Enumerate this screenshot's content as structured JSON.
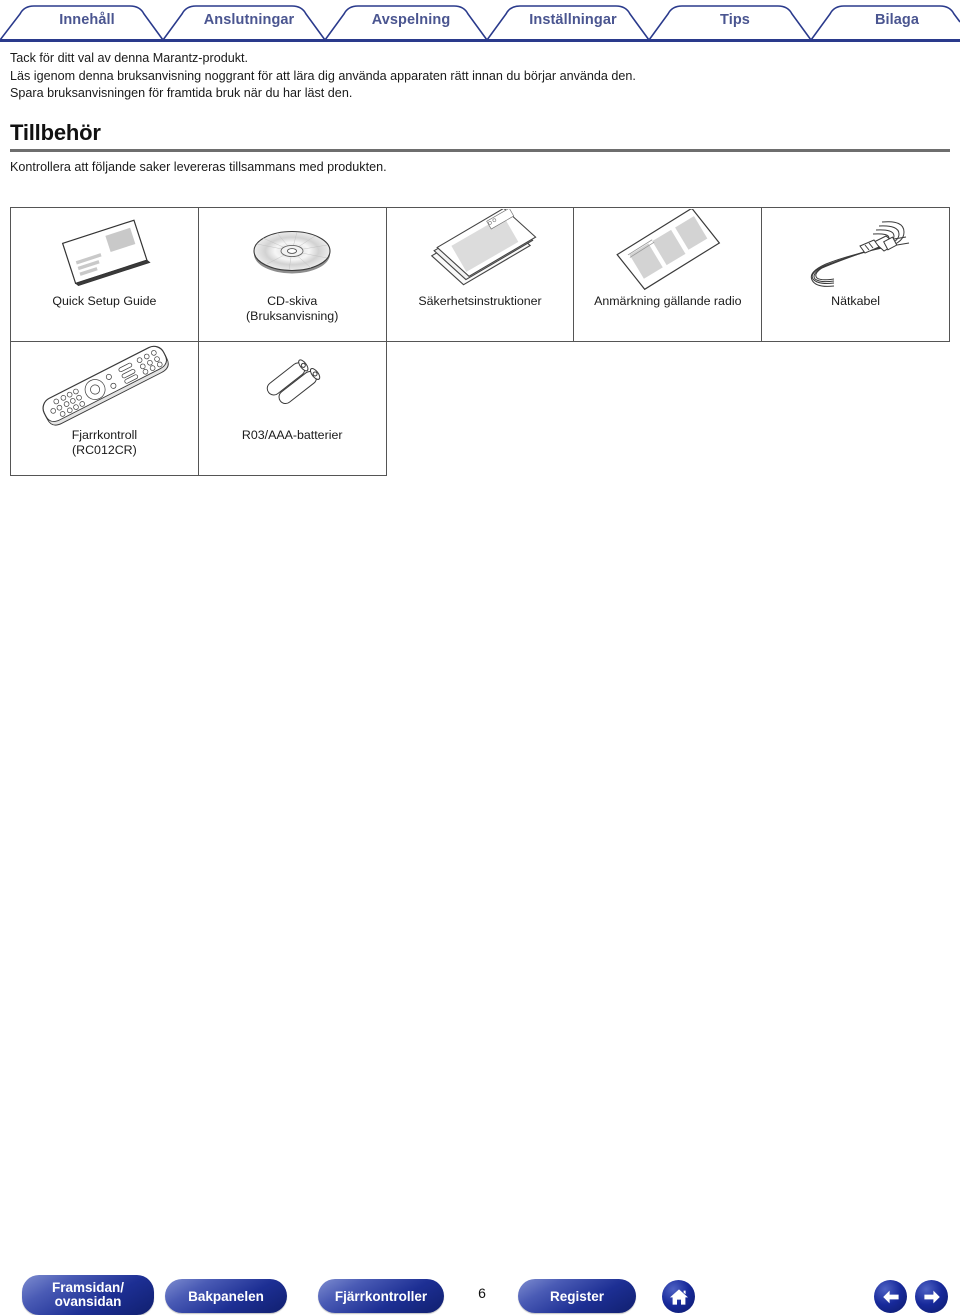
{
  "tabs": [
    {
      "label": "Innehåll"
    },
    {
      "label": "Anslutningar"
    },
    {
      "label": "Avspelning"
    },
    {
      "label": "Inställningar"
    },
    {
      "label": "Tips"
    },
    {
      "label": "Bilaga"
    }
  ],
  "intro": {
    "line1": "Tack för ditt val av denna Marantz-produkt.",
    "line2": "Läs igenom denna bruksanvisning noggrant för att lära dig använda apparaten rätt innan du börjar använda den.",
    "line3": "Spara bruksanvisningen för framtida bruk när du har läst den."
  },
  "section": {
    "heading": "Tillbehör",
    "subtitle": "Kontrollera att följande saker levereras tillsammans med produkten."
  },
  "accessories": [
    {
      "icon": "booklet-icon",
      "label": "Quick Setup Guide",
      "label2": ""
    },
    {
      "icon": "cd-disc-icon",
      "label": "CD-skiva",
      "label2": "(Bruksanvisning)"
    },
    {
      "icon": "papers-icon",
      "label": "Säkerhetsinstruktioner",
      "label2": ""
    },
    {
      "icon": "leaflet-icon",
      "label": "Anmärkning gällande radio",
      "label2": ""
    },
    {
      "icon": "power-cord-icon",
      "label": "Nätkabel",
      "label2": ""
    },
    {
      "icon": "remote-icon",
      "label": "Fjarrkontroll",
      "label2": "(RC012CR)"
    },
    {
      "icon": "batteries-icon",
      "label": "R03/AAA-batterier",
      "label2": ""
    }
  ],
  "bottom": {
    "buttons": [
      {
        "label_line1": "Framsidan/",
        "label_line2": "ovansidan"
      },
      {
        "label_line1": "Bakpanelen",
        "label_line2": ""
      },
      {
        "label_line1": "Fjärrkontroller",
        "label_line2": ""
      },
      {
        "label_line1": "Register",
        "label_line2": ""
      }
    ],
    "page_number": "6",
    "home_icon": "home-icon",
    "back_icon": "arrow-left-icon",
    "forward_icon": "arrow-right-icon"
  },
  "colors": {
    "tab_text": "#4a5590",
    "tab_line": "#2a3a8c",
    "rule": "#6e6e6e",
    "pill_dark": "#101f6e",
    "pill_light": "#7e8dd0"
  }
}
